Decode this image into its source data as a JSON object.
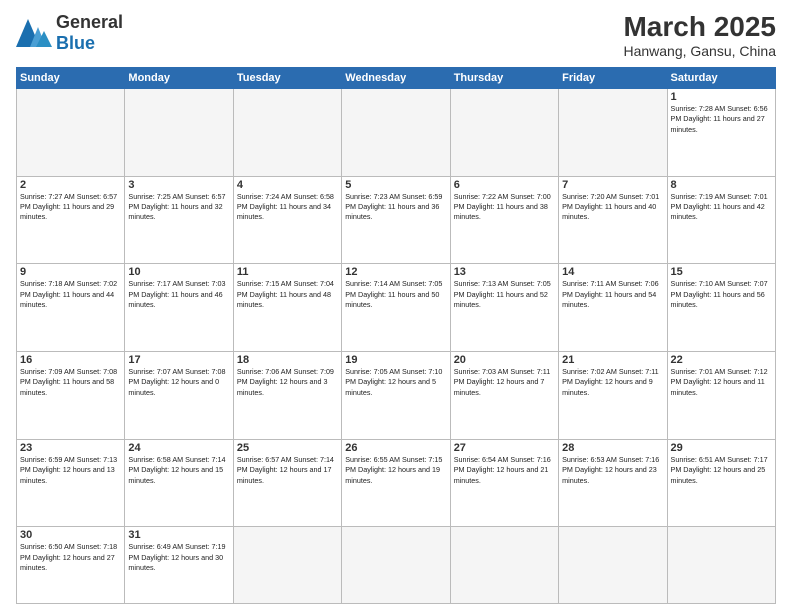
{
  "header": {
    "logo_general": "General",
    "logo_blue": "Blue",
    "month_year": "March 2025",
    "location": "Hanwang, Gansu, China"
  },
  "days_of_week": [
    "Sunday",
    "Monday",
    "Tuesday",
    "Wednesday",
    "Thursday",
    "Friday",
    "Saturday"
  ],
  "weeks": [
    [
      {
        "day": "",
        "info": ""
      },
      {
        "day": "",
        "info": ""
      },
      {
        "day": "",
        "info": ""
      },
      {
        "day": "",
        "info": ""
      },
      {
        "day": "",
        "info": ""
      },
      {
        "day": "",
        "info": ""
      },
      {
        "day": "1",
        "info": "Sunrise: 7:28 AM\nSunset: 6:56 PM\nDaylight: 11 hours\nand 27 minutes."
      }
    ],
    [
      {
        "day": "2",
        "info": "Sunrise: 7:27 AM\nSunset: 6:57 PM\nDaylight: 11 hours\nand 29 minutes."
      },
      {
        "day": "3",
        "info": "Sunrise: 7:25 AM\nSunset: 6:57 PM\nDaylight: 11 hours\nand 32 minutes."
      },
      {
        "day": "4",
        "info": "Sunrise: 7:24 AM\nSunset: 6:58 PM\nDaylight: 11 hours\nand 34 minutes."
      },
      {
        "day": "5",
        "info": "Sunrise: 7:23 AM\nSunset: 6:59 PM\nDaylight: 11 hours\nand 36 minutes."
      },
      {
        "day": "6",
        "info": "Sunrise: 7:22 AM\nSunset: 7:00 PM\nDaylight: 11 hours\nand 38 minutes."
      },
      {
        "day": "7",
        "info": "Sunrise: 7:20 AM\nSunset: 7:01 PM\nDaylight: 11 hours\nand 40 minutes."
      },
      {
        "day": "8",
        "info": "Sunrise: 7:19 AM\nSunset: 7:01 PM\nDaylight: 11 hours\nand 42 minutes."
      }
    ],
    [
      {
        "day": "9",
        "info": "Sunrise: 7:18 AM\nSunset: 7:02 PM\nDaylight: 11 hours\nand 44 minutes."
      },
      {
        "day": "10",
        "info": "Sunrise: 7:17 AM\nSunset: 7:03 PM\nDaylight: 11 hours\nand 46 minutes."
      },
      {
        "day": "11",
        "info": "Sunrise: 7:15 AM\nSunset: 7:04 PM\nDaylight: 11 hours\nand 48 minutes."
      },
      {
        "day": "12",
        "info": "Sunrise: 7:14 AM\nSunset: 7:05 PM\nDaylight: 11 hours\nand 50 minutes."
      },
      {
        "day": "13",
        "info": "Sunrise: 7:13 AM\nSunset: 7:05 PM\nDaylight: 11 hours\nand 52 minutes."
      },
      {
        "day": "14",
        "info": "Sunrise: 7:11 AM\nSunset: 7:06 PM\nDaylight: 11 hours\nand 54 minutes."
      },
      {
        "day": "15",
        "info": "Sunrise: 7:10 AM\nSunset: 7:07 PM\nDaylight: 11 hours\nand 56 minutes."
      }
    ],
    [
      {
        "day": "16",
        "info": "Sunrise: 7:09 AM\nSunset: 7:08 PM\nDaylight: 11 hours\nand 58 minutes."
      },
      {
        "day": "17",
        "info": "Sunrise: 7:07 AM\nSunset: 7:08 PM\nDaylight: 12 hours\nand 0 minutes."
      },
      {
        "day": "18",
        "info": "Sunrise: 7:06 AM\nSunset: 7:09 PM\nDaylight: 12 hours\nand 3 minutes."
      },
      {
        "day": "19",
        "info": "Sunrise: 7:05 AM\nSunset: 7:10 PM\nDaylight: 12 hours\nand 5 minutes."
      },
      {
        "day": "20",
        "info": "Sunrise: 7:03 AM\nSunset: 7:11 PM\nDaylight: 12 hours\nand 7 minutes."
      },
      {
        "day": "21",
        "info": "Sunrise: 7:02 AM\nSunset: 7:11 PM\nDaylight: 12 hours\nand 9 minutes."
      },
      {
        "day": "22",
        "info": "Sunrise: 7:01 AM\nSunset: 7:12 PM\nDaylight: 12 hours\nand 11 minutes."
      }
    ],
    [
      {
        "day": "23",
        "info": "Sunrise: 6:59 AM\nSunset: 7:13 PM\nDaylight: 12 hours\nand 13 minutes."
      },
      {
        "day": "24",
        "info": "Sunrise: 6:58 AM\nSunset: 7:14 PM\nDaylight: 12 hours\nand 15 minutes."
      },
      {
        "day": "25",
        "info": "Sunrise: 6:57 AM\nSunset: 7:14 PM\nDaylight: 12 hours\nand 17 minutes."
      },
      {
        "day": "26",
        "info": "Sunrise: 6:55 AM\nSunset: 7:15 PM\nDaylight: 12 hours\nand 19 minutes."
      },
      {
        "day": "27",
        "info": "Sunrise: 6:54 AM\nSunset: 7:16 PM\nDaylight: 12 hours\nand 21 minutes."
      },
      {
        "day": "28",
        "info": "Sunrise: 6:53 AM\nSunset: 7:16 PM\nDaylight: 12 hours\nand 23 minutes."
      },
      {
        "day": "29",
        "info": "Sunrise: 6:51 AM\nSunset: 7:17 PM\nDaylight: 12 hours\nand 25 minutes."
      }
    ],
    [
      {
        "day": "30",
        "info": "Sunrise: 6:50 AM\nSunset: 7:18 PM\nDaylight: 12 hours\nand 27 minutes."
      },
      {
        "day": "31",
        "info": "Sunrise: 6:49 AM\nSunset: 7:19 PM\nDaylight: 12 hours\nand 30 minutes."
      },
      {
        "day": "",
        "info": ""
      },
      {
        "day": "",
        "info": ""
      },
      {
        "day": "",
        "info": ""
      },
      {
        "day": "",
        "info": ""
      },
      {
        "day": "",
        "info": ""
      }
    ]
  ]
}
